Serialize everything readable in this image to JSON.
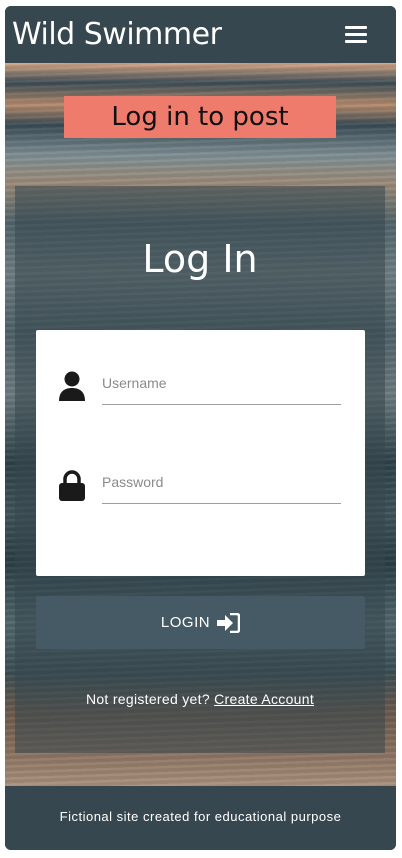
{
  "navbar": {
    "brand": "Wild Swimmer",
    "menu_icon": "hamburger-menu-icon"
  },
  "banner": {
    "text": "Log in to post",
    "color": "#ef7b6d"
  },
  "login": {
    "title": "Log In",
    "username": {
      "placeholder": "Username",
      "value": "",
      "icon": "user-icon"
    },
    "password": {
      "placeholder": "Password",
      "value": "",
      "icon": "lock-icon"
    },
    "button_label": "LOGIN",
    "button_icon": "sign-in-icon",
    "register_prompt": "Not registered yet?",
    "register_link": "Create Account"
  },
  "footer": {
    "text": "Fictional site created for educational purpose"
  },
  "colors": {
    "primary": "#37474f",
    "button": "#455a64",
    "accent": "#ef7b6d"
  }
}
